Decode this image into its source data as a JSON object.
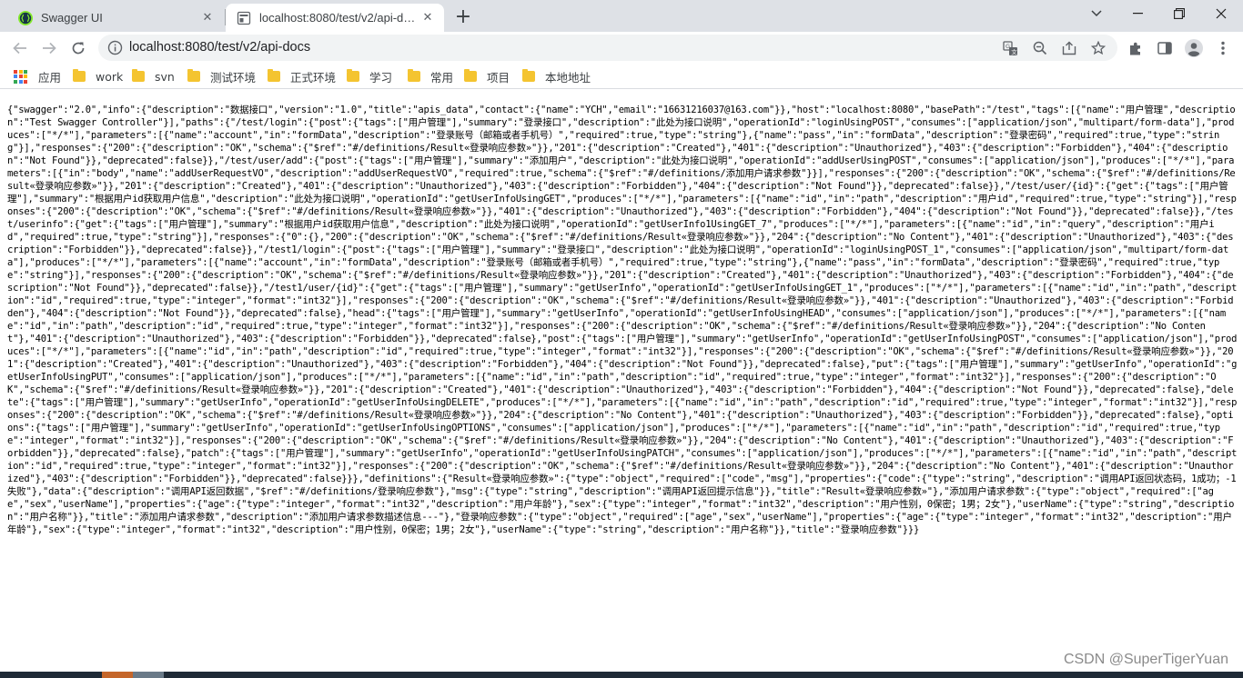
{
  "browser": {
    "tabs": [
      {
        "title": "Swagger UI",
        "icon": "swagger-favicon",
        "active": false
      },
      {
        "title": "localhost:8080/test/v2/api-docs",
        "icon": "page-favicon",
        "active": true
      }
    ],
    "url": "localhost:8080/test/v2/api-docs",
    "accent_color": "#1a73e8"
  },
  "bookmarks": [
    {
      "label": "应用",
      "icon": "apps-grid-icon"
    },
    {
      "label": "work",
      "icon": "folder-icon"
    },
    {
      "label": "svn",
      "icon": "folder-icon"
    },
    {
      "label": "测试环境",
      "icon": "folder-icon"
    },
    {
      "label": "正式环境",
      "icon": "folder-icon"
    },
    {
      "label": "学习",
      "icon": "folder-icon"
    },
    {
      "label": "常用",
      "icon": "folder-icon"
    },
    {
      "label": "项目",
      "icon": "folder-icon"
    },
    {
      "label": "本地地址",
      "icon": "folder-icon"
    }
  ],
  "page": {
    "json_text": "{\"swagger\":\"2.0\",\"info\":{\"description\":\"数据接口\",\"version\":\"1.0\",\"title\":\"apis_data\",\"contact\":{\"name\":\"YCH\",\"email\":\"16631216037@163.com\"}},\"host\":\"localhost:8080\",\"basePath\":\"/test\",\"tags\":[{\"name\":\"用户管理\",\"description\":\"Test Swagger Controller\"}],\"paths\":{\"/test/login\":{\"post\":{\"tags\":[\"用户管理\"],\"summary\":\"登录接口\",\"description\":\"此处为接口说明\",\"operationId\":\"loginUsingPOST\",\"consumes\":[\"application/json\",\"multipart/form-data\"],\"produces\":[\"*/*\"],\"parameters\":[{\"name\":\"account\",\"in\":\"formData\",\"description\":\"登录账号（邮箱或者手机号）\",\"required\":true,\"type\":\"string\"},{\"name\":\"pass\",\"in\":\"formData\",\"description\":\"登录密码\",\"required\":true,\"type\":\"string\"}],\"responses\":{\"200\":{\"description\":\"OK\",\"schema\":{\"$ref\":\"#/definitions/Result«登录响应参数»\"}},\"201\":{\"description\":\"Created\"},\"401\":{\"description\":\"Unauthorized\"},\"403\":{\"description\":\"Forbidden\"},\"404\":{\"description\":\"Not Found\"}},\"deprecated\":false}},\"/test/user/add\":{\"post\":{\"tags\":[\"用户管理\"],\"summary\":\"添加用户\",\"description\":\"此处为接口说明\",\"operationId\":\"addUserUsingPOST\",\"consumes\":[\"application/json\"],\"produces\":[\"*/*\"],\"parameters\":[{\"in\":\"body\",\"name\":\"addUserRequestVO\",\"description\":\"addUserRequestVO\",\"required\":true,\"schema\":{\"$ref\":\"#/definitions/添加用户请求参数\"}}],\"responses\":{\"200\":{\"description\":\"OK\",\"schema\":{\"$ref\":\"#/definitions/Result«登录响应参数»\"}},\"201\":{\"description\":\"Created\"},\"401\":{\"description\":\"Unauthorized\"},\"403\":{\"description\":\"Forbidden\"},\"404\":{\"description\":\"Not Found\"}},\"deprecated\":false}},\"/test/user/{id}\":{\"get\":{\"tags\":[\"用户管理\"],\"summary\":\"根据用户id获取用户信息\",\"description\":\"此处为接口说明\",\"operationId\":\"getUserInfoUsingGET\",\"produces\":[\"*/*\"],\"parameters\":[{\"name\":\"id\",\"in\":\"path\",\"description\":\"用户id\",\"required\":true,\"type\":\"string\"}],\"responses\":{\"200\":{\"description\":\"OK\",\"schema\":{\"$ref\":\"#/definitions/Result«登录响应参数»\"}},\"401\":{\"description\":\"Unauthorized\"},\"403\":{\"description\":\"Forbidden\"},\"404\":{\"description\":\"Not Found\"}},\"deprecated\":false}},\"/test/userinfo\":{\"get\":{\"tags\":[\"用户管理\"],\"summary\":\"根据用户id获取用户信息\",\"description\":\"此处为接口说明\",\"operationId\":\"getUserInfo1UsingGET_7\",\"produces\":[\"*/*\"],\"parameters\":[{\"name\":\"id\",\"in\":\"query\",\"description\":\"用户id\",\"required\":true,\"type\":\"string\"}],\"responses\":{\"0\":{},\"200\":{\"description\":\"OK\",\"schema\":{\"$ref\":\"#/definitions/Result«登录响应参数»\"}},\"204\":{\"description\":\"No Content\"},\"401\":{\"description\":\"Unauthorized\"},\"403\":{\"description\":\"Forbidden\"}},\"deprecated\":false}},\"/test1/login\":{\"post\":{\"tags\":[\"用户管理\"],\"summary\":\"登录接口\",\"description\":\"此处为接口说明\",\"operationId\":\"loginUsingPOST_1\",\"consumes\":[\"application/json\",\"multipart/form-data\"],\"produces\":[\"*/*\"],\"parameters\":[{\"name\":\"account\",\"in\":\"formData\",\"description\":\"登录账号（邮箱或者手机号）\",\"required\":true,\"type\":\"string\"},{\"name\":\"pass\",\"in\":\"formData\",\"description\":\"登录密码\",\"required\":true,\"type\":\"string\"}],\"responses\":{\"200\":{\"description\":\"OK\",\"schema\":{\"$ref\":\"#/definitions/Result«登录响应参数»\"}},\"201\":{\"description\":\"Created\"},\"401\":{\"description\":\"Unauthorized\"},\"403\":{\"description\":\"Forbidden\"},\"404\":{\"description\":\"Not Found\"}},\"deprecated\":false}},\"/test1/user/{id}\":{\"get\":{\"tags\":[\"用户管理\"],\"summary\":\"getUserInfo\",\"operationId\":\"getUserInfoUsingGET_1\",\"produces\":[\"*/*\"],\"parameters\":[{\"name\":\"id\",\"in\":\"path\",\"description\":\"id\",\"required\":true,\"type\":\"integer\",\"format\":\"int32\"}],\"responses\":{\"200\":{\"description\":\"OK\",\"schema\":{\"$ref\":\"#/definitions/Result«登录响应参数»\"}},\"401\":{\"description\":\"Unauthorized\"},\"403\":{\"description\":\"Forbidden\"},\"404\":{\"description\":\"Not Found\"}},\"deprecated\":false},\"head\":{\"tags\":[\"用户管理\"],\"summary\":\"getUserInfo\",\"operationId\":\"getUserInfoUsingHEAD\",\"consumes\":[\"application/json\"],\"produces\":[\"*/*\"],\"parameters\":[{\"name\":\"id\",\"in\":\"path\",\"description\":\"id\",\"required\":true,\"type\":\"integer\",\"format\":\"int32\"}],\"responses\":{\"200\":{\"description\":\"OK\",\"schema\":{\"$ref\":\"#/definitions/Result«登录响应参数»\"}},\"204\":{\"description\":\"No Content\"},\"401\":{\"description\":\"Unauthorized\"},\"403\":{\"description\":\"Forbidden\"}},\"deprecated\":false},\"post\":{\"tags\":[\"用户管理\"],\"summary\":\"getUserInfo\",\"operationId\":\"getUserInfoUsingPOST\",\"consumes\":[\"application/json\"],\"produces\":[\"*/*\"],\"parameters\":[{\"name\":\"id\",\"in\":\"path\",\"description\":\"id\",\"required\":true,\"type\":\"integer\",\"format\":\"int32\"}],\"responses\":{\"200\":{\"description\":\"OK\",\"schema\":{\"$ref\":\"#/definitions/Result«登录响应参数»\"}},\"201\":{\"description\":\"Created\"},\"401\":{\"description\":\"Unauthorized\"},\"403\":{\"description\":\"Forbidden\"},\"404\":{\"description\":\"Not Found\"}},\"deprecated\":false},\"put\":{\"tags\":[\"用户管理\"],\"summary\":\"getUserInfo\",\"operationId\":\"getUserInfoUsingPUT\",\"consumes\":[\"application/json\"],\"produces\":[\"*/*\"],\"parameters\":[{\"name\":\"id\",\"in\":\"path\",\"description\":\"id\",\"required\":true,\"type\":\"integer\",\"format\":\"int32\"}],\"responses\":{\"200\":{\"description\":\"OK\",\"schema\":{\"$ref\":\"#/definitions/Result«登录响应参数»\"}},\"201\":{\"description\":\"Created\"},\"401\":{\"description\":\"Unauthorized\"},\"403\":{\"description\":\"Forbidden\"},\"404\":{\"description\":\"Not Found\"}},\"deprecated\":false},\"delete\":{\"tags\":[\"用户管理\"],\"summary\":\"getUserInfo\",\"operationId\":\"getUserInfoUsingDELETE\",\"produces\":[\"*/*\"],\"parameters\":[{\"name\":\"id\",\"in\":\"path\",\"description\":\"id\",\"required\":true,\"type\":\"integer\",\"format\":\"int32\"}],\"responses\":{\"200\":{\"description\":\"OK\",\"schema\":{\"$ref\":\"#/definitions/Result«登录响应参数»\"}},\"204\":{\"description\":\"No Content\"},\"401\":{\"description\":\"Unauthorized\"},\"403\":{\"description\":\"Forbidden\"}},\"deprecated\":false},\"options\":{\"tags\":[\"用户管理\"],\"summary\":\"getUserInfo\",\"operationId\":\"getUserInfoUsingOPTIONS\",\"consumes\":[\"application/json\"],\"produces\":[\"*/*\"],\"parameters\":[{\"name\":\"id\",\"in\":\"path\",\"description\":\"id\",\"required\":true,\"type\":\"integer\",\"format\":\"int32\"}],\"responses\":{\"200\":{\"description\":\"OK\",\"schema\":{\"$ref\":\"#/definitions/Result«登录响应参数»\"}},\"204\":{\"description\":\"No Content\"},\"401\":{\"description\":\"Unauthorized\"},\"403\":{\"description\":\"Forbidden\"}},\"deprecated\":false},\"patch\":{\"tags\":[\"用户管理\"],\"summary\":\"getUserInfo\",\"operationId\":\"getUserInfoUsingPATCH\",\"consumes\":[\"application/json\"],\"produces\":[\"*/*\"],\"parameters\":[{\"name\":\"id\",\"in\":\"path\",\"description\":\"id\",\"required\":true,\"type\":\"integer\",\"format\":\"int32\"}],\"responses\":{\"200\":{\"description\":\"OK\",\"schema\":{\"$ref\":\"#/definitions/Result«登录响应参数»\"}},\"204\":{\"description\":\"No Content\"},\"401\":{\"description\":\"Unauthorized\"},\"403\":{\"description\":\"Forbidden\"}},\"deprecated\":false}}},\"definitions\":{\"Result«登录响应参数»\":{\"type\":\"object\",\"required\":[\"code\",\"msg\"],\"properties\":{\"code\":{\"type\":\"string\",\"description\":\"调用API返回状态码，1成功；-1失败\"},\"data\":{\"description\":\"调用API返回数据\",\"$ref\":\"#/definitions/登录响应参数\"},\"msg\":{\"type\":\"string\",\"description\":\"调用API返回提示信息\"}},\"title\":\"Result«登录响应参数»\"},\"添加用户请求参数\":{\"type\":\"object\",\"required\":[\"age\",\"sex\",\"userName\"],\"properties\":{\"age\":{\"type\":\"integer\",\"format\":\"int32\",\"description\":\"用户年龄\"},\"sex\":{\"type\":\"integer\",\"format\":\"int32\",\"description\":\"用户性别，0保密；1男；2女\"},\"userName\":{\"type\":\"string\",\"description\":\"用户名称\"}},\"title\":\"添加用户请求参数\",\"description\":\"添加用户请求参数描述信息---\"},\"登录响应参数\":{\"type\":\"object\",\"required\":[\"age\",\"sex\",\"userName\"],\"properties\":{\"age\":{\"type\":\"integer\",\"format\":\"int32\",\"description\":\"用户年龄\"},\"sex\":{\"type\":\"integer\",\"format\":\"int32\",\"description\":\"用户性别，0保密；1男；2女\"},\"userName\":{\"type\":\"string\",\"description\":\"用户名称\"}},\"title\":\"登录响应参数\"}}}"
  },
  "watermark": "CSDN @SuperTigerYuan"
}
